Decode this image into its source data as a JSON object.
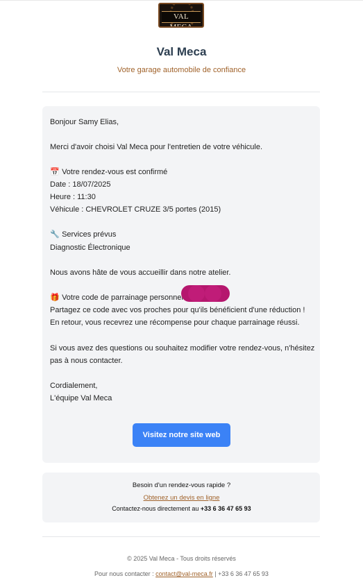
{
  "header": {
    "logo_text": "VAL MECA",
    "title": "Val Meca",
    "tagline": "Votre garage automobile de confiance"
  },
  "message": {
    "greeting": "Bonjour Samy Elias,",
    "thanks": "Merci d'avoir choisi Val Meca pour l'entretien de votre véhicule.",
    "appointment_icon": "📅",
    "appointment_heading": "Votre rendez-vous est confirmé",
    "date": "Date : 18/07/2025",
    "time": "Heure : 11:30",
    "vehicle": "Véhicule : CHEVROLET CRUZE 3/5 portes (2015)",
    "services_icon": "🔧",
    "services_heading": "Services prévus",
    "service_item": "Diagnostic Électronique",
    "welcome": "Nous avons hâte de vous accueillir dans notre atelier.",
    "referral_icon": "🎁",
    "referral_heading": "Votre code de parrainage personnel :",
    "referral_share": "Partagez ce code avec vos proches pour qu'ils bénéficient d'une réduction !",
    "referral_reward": "En retour, vous recevrez une récompense pour chaque parrainage réussi.",
    "questions_line1": "Si vous avez des questions ou souhaitez modifier votre rendez-vous, n'hésitez",
    "questions_line2": "pas à nous contacter.",
    "closing": "Cordialement,",
    "signature": "L'équipe Val Meca",
    "cta_label": "Visitez notre site web"
  },
  "quote": {
    "question": "Besoin d'un rendez-vous rapide ?",
    "link_label": "Obtenez un devis en ligne",
    "contact_prefix": "Contactez-nous directement au ",
    "phone": "+33 6 36 47 65 93"
  },
  "footer": {
    "copyright": "© 2025 Val Meca - Tous droits réservés",
    "contact_prefix": "Pour nous contacter : ",
    "email": "contact@val-meca.fr",
    "separator": " | ",
    "phone": "+33 6 36 47 65 93"
  },
  "colors": {
    "accent": "#3b82f6",
    "brand_brown": "#a0622a",
    "title": "#2c3e50",
    "card_bg": "#f3f4f6",
    "redaction": "#c01c78"
  }
}
